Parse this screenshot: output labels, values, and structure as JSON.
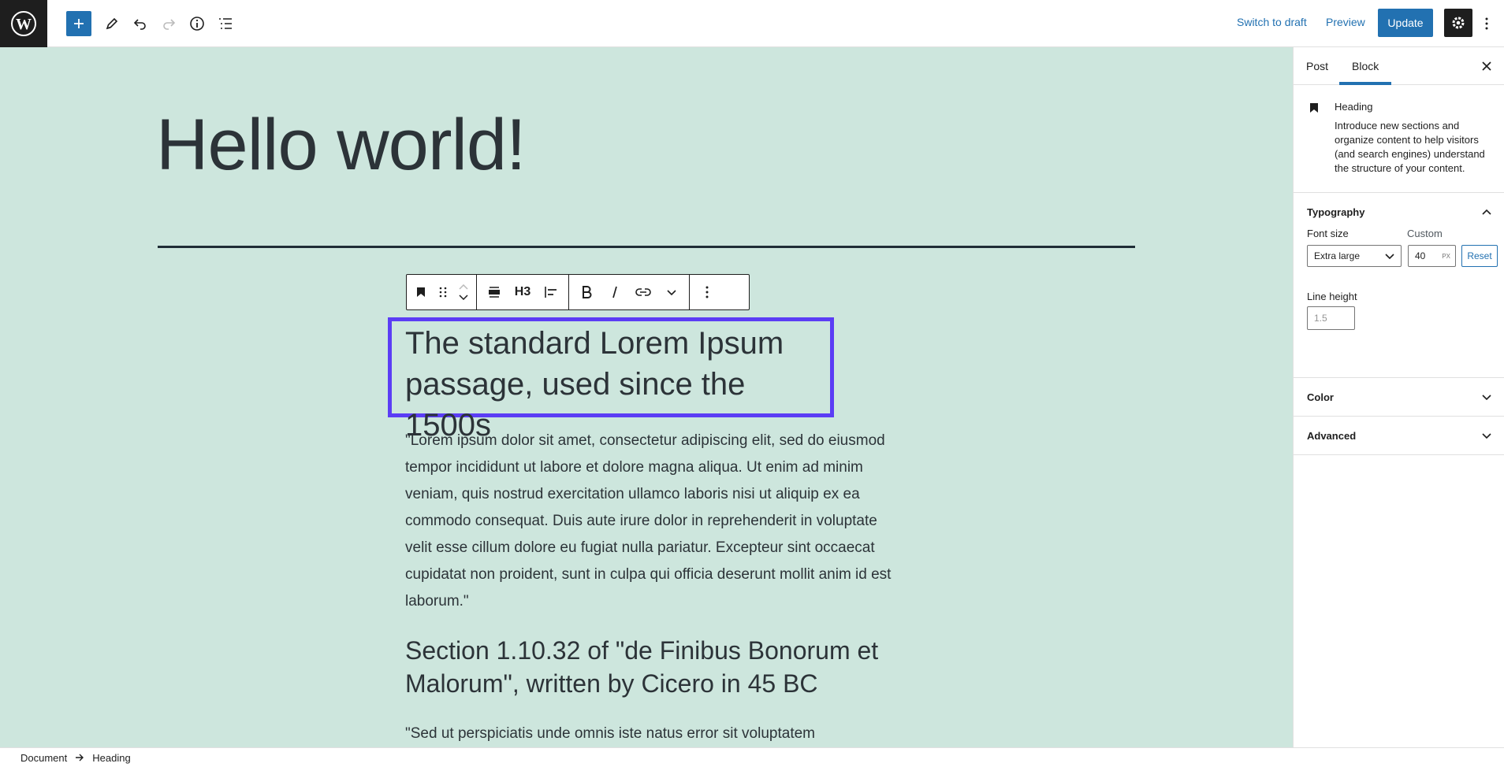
{
  "topbar": {
    "switch_to_draft": "Switch to draft",
    "preview": "Preview",
    "update": "Update"
  },
  "post": {
    "title": "Hello world!",
    "selected_heading": "The standard Lorem Ipsum passage, used since the 1500s",
    "paragraph1": "\"Lorem ipsum dolor sit amet, consectetur adipiscing elit, sed do eiusmod tempor incididunt ut labore et dolore magna aliqua. Ut enim ad minim veniam, quis nostrud exercitation ullamco laboris nisi ut aliquip ex ea commodo consequat. Duis aute irure dolor in reprehenderit in voluptate velit esse cillum dolore eu fugiat nulla pariatur. Excepteur sint occaecat cupidatat non proident, sunt in culpa qui officia deserunt mollit anim id est laborum.\"",
    "subheading": "Section 1.10.32 of \"de Finibus Bonorum et Malorum\", written by Cicero in 45 BC",
    "paragraph2": "\"Sed ut perspiciatis unde omnis iste natus error sit voluptatem"
  },
  "block_toolbar": {
    "heading_level": "H3"
  },
  "breadcrumb": {
    "items": [
      "Document",
      "Heading"
    ]
  },
  "sidebar": {
    "tabs": [
      "Post",
      "Block"
    ],
    "active_tab": "Block",
    "block": {
      "name": "Heading",
      "description": "Introduce new sections and organize content to help visitors (and search engines) understand the structure of your content."
    },
    "typography": {
      "title": "Typography",
      "font_size_label": "Font size",
      "custom_label": "Custom",
      "font_size_value": "Extra large",
      "custom_value": "40",
      "custom_unit": "PX",
      "reset_label": "Reset",
      "line_height_label": "Line height",
      "line_height_placeholder": "1.5"
    },
    "color_panel": "Color",
    "advanced_panel": "Advanced"
  },
  "colors": {
    "accent": "#2271b1",
    "canvas_bg": "#cde6dd",
    "selection": "#5b3df5",
    "dark": "#1e1e1e"
  },
  "icons": [
    "wordpress-logo-icon",
    "plus-icon",
    "pencil-icon",
    "undo-icon",
    "redo-icon",
    "info-icon",
    "list-view-icon",
    "gear-icon",
    "more-vertical-icon",
    "bookmark-icon",
    "drag-handle-icon",
    "chevron-up-icon",
    "chevron-down-icon",
    "align-wide-icon",
    "align-left-icon",
    "bold-icon",
    "italic-icon",
    "link-icon",
    "close-icon",
    "arrow-right-icon"
  ]
}
